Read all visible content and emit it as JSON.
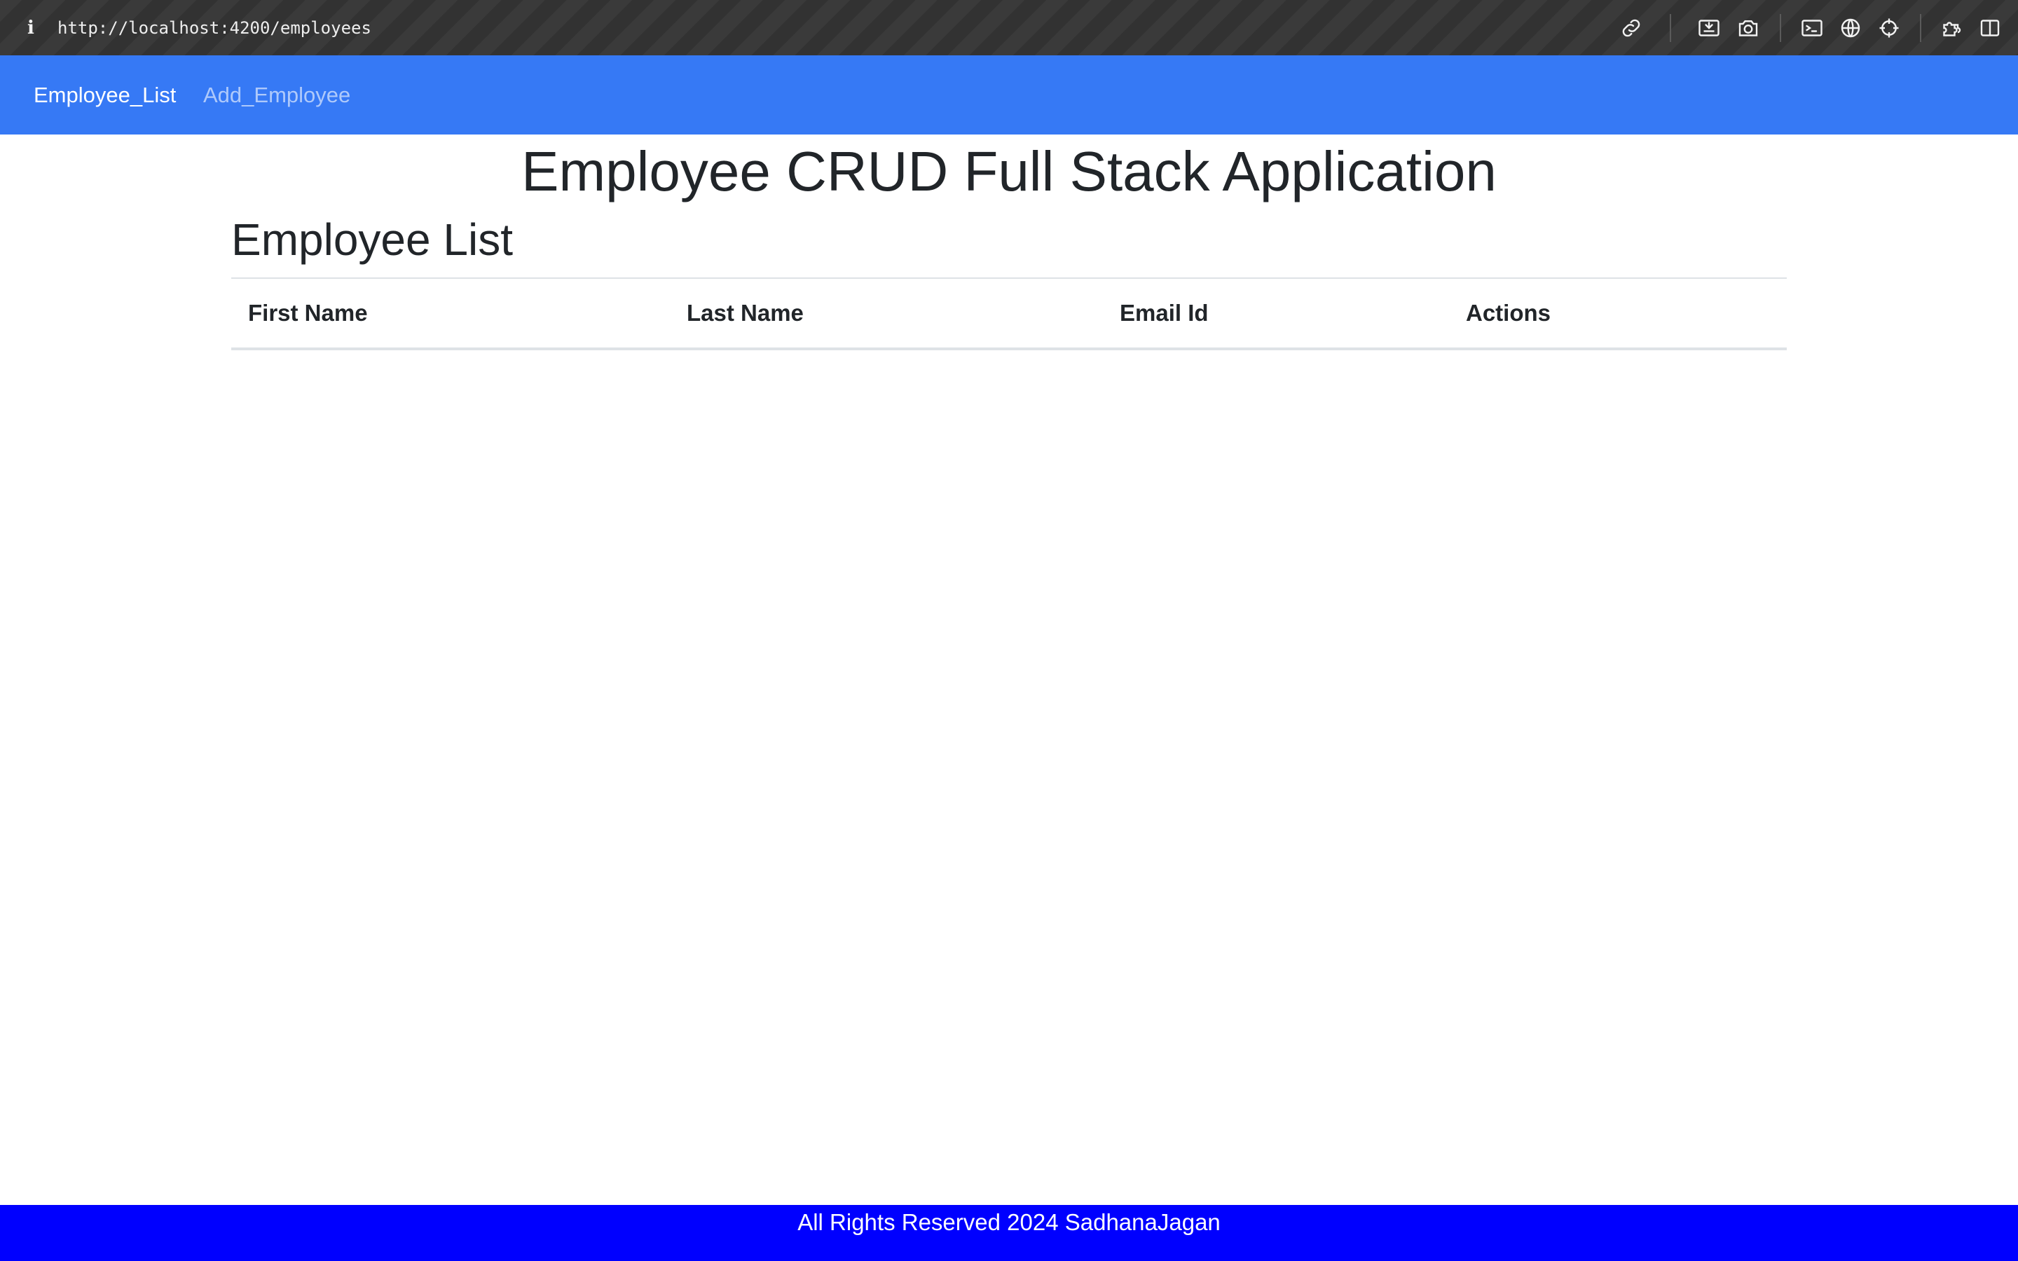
{
  "browser": {
    "url": "http://localhost:4200/employees",
    "icons": [
      "info-icon",
      "link-icon",
      "screencast-icon",
      "camera-icon",
      "terminal-icon",
      "globe-icon",
      "crosshair-icon",
      "extensions-icon",
      "sidebar-icon"
    ]
  },
  "navbar": {
    "color": "#3679f5",
    "links": [
      {
        "label": "Employee_List",
        "active": true
      },
      {
        "label": "Add_Employee",
        "active": false
      }
    ]
  },
  "main": {
    "app_title": "Employee CRUD Full Stack Application",
    "list_title": "Employee List",
    "table": {
      "columns": [
        "First Name",
        "Last Name",
        "Email Id",
        "Actions"
      ],
      "rows": []
    }
  },
  "footer": {
    "text": "All Rights Reserved 2024 SadhanaJagan",
    "color": "#0000ff"
  }
}
